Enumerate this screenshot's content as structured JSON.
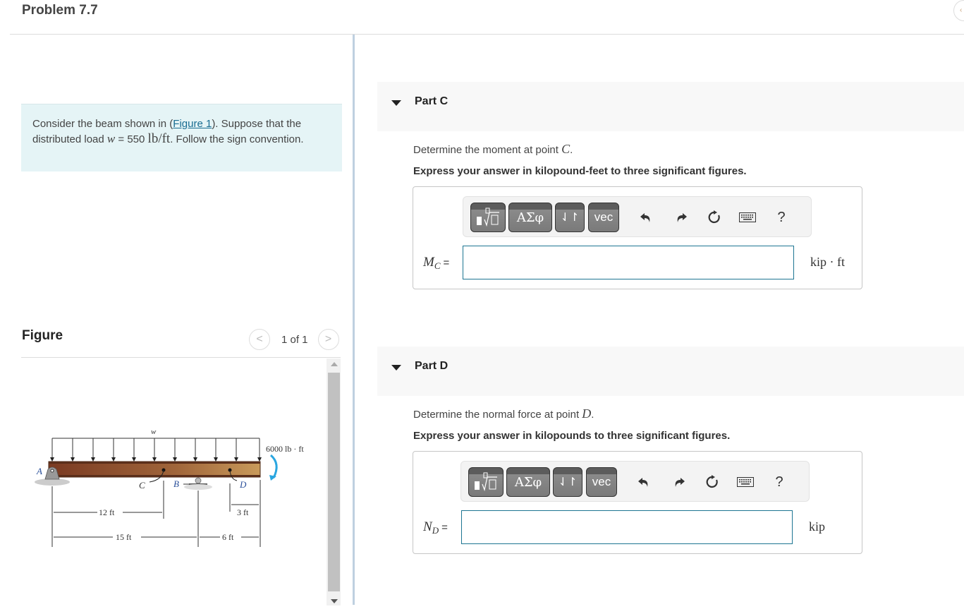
{
  "header": {
    "title": "Problem 7.7"
  },
  "intro": {
    "text_before_link": "Consider the beam shown in (",
    "link_label": "Figure 1",
    "text_after_link": "). Suppose that the distributed load ",
    "var": "w",
    "eq": " = 550 ",
    "unit": "lb/ft",
    "text_end": ". Follow the sign convention."
  },
  "figure": {
    "title": "Figure",
    "pager": "1 of 1",
    "prev_icon": "chevron-left",
    "next_icon": "chevron-right",
    "labels": {
      "load": "w",
      "moment": "6000 lb · ft",
      "A": "A",
      "B": "B",
      "C": "C",
      "D": "D",
      "dim_12": "12 ft",
      "dim_15": "15 ft",
      "dim_3": "3 ft",
      "dim_6": "6 ft"
    }
  },
  "parts": [
    {
      "label": "Part C",
      "question_prefix": "Determine the moment at point ",
      "question_var": "C",
      "question_suffix": ".",
      "instruction": "Express your answer in kilopound-feet to three significant figures.",
      "var_main": "M",
      "var_sub": "C",
      "equals": "=",
      "answer_value": "",
      "unit": "kip · ft"
    },
    {
      "label": "Part D",
      "question_prefix": "Determine the normal force at point ",
      "question_var": "D",
      "question_suffix": ".",
      "instruction": "Express your answer in kilopounds to three significant figures.",
      "var_main": "N",
      "var_sub": "D",
      "equals": "=",
      "answer_value": "",
      "unit": "kip"
    }
  ],
  "toolbar": {
    "templates_icon": "fraction-root-template",
    "greek_label": "ΑΣφ",
    "arrows_label": "⇃↾",
    "vec_label": "vec",
    "undo_icon": "undo",
    "redo_icon": "redo",
    "reset_icon": "reset",
    "keyboard_icon": "keyboard",
    "help_label": "?"
  }
}
